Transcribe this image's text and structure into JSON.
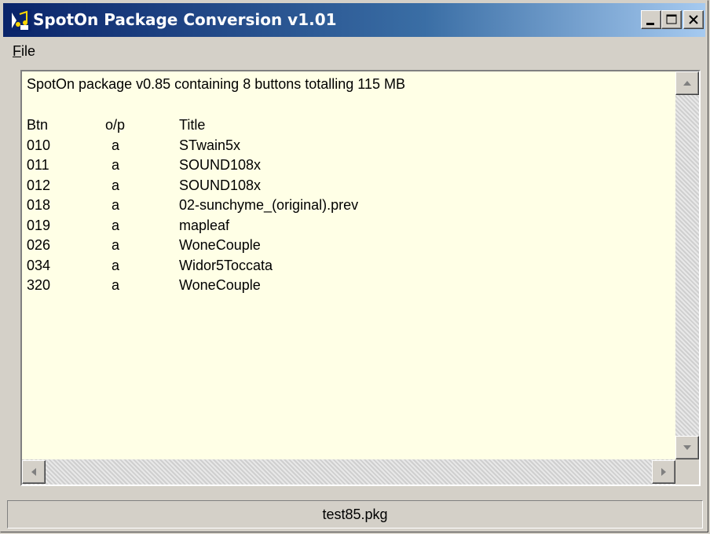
{
  "window": {
    "title": "SpotOn Package Conversion v1.01",
    "icon": "music-note-icon"
  },
  "menu": {
    "file_accel": "F",
    "file_rest": "ile"
  },
  "content": {
    "summary": "SpotOn package v0.85 containing 8 buttons totalling 115 MB",
    "columns": [
      "Btn",
      "o/p",
      "Title"
    ],
    "rows": [
      {
        "btn": "010",
        "op": "a",
        "title": "STwain5x"
      },
      {
        "btn": "011",
        "op": "a",
        "title": "SOUND108x"
      },
      {
        "btn": "012",
        "op": "a",
        "title": "SOUND108x"
      },
      {
        "btn": "018",
        "op": "a",
        "title": "02-sunchyme_(original).prev"
      },
      {
        "btn": "019",
        "op": "a",
        "title": "mapleaf"
      },
      {
        "btn": "026",
        "op": "a",
        "title": "WoneCouple"
      },
      {
        "btn": "034",
        "op": "a",
        "title": "Widor5Toccata"
      },
      {
        "btn": "320",
        "op": "a",
        "title": "WoneCouple"
      }
    ]
  },
  "statusbar": {
    "filename": "test85.pkg"
  },
  "colors": {
    "title_start": "#0a246a",
    "title_end": "#a6caf0",
    "text_bg": "#ffffe6",
    "face": "#d4d0c8"
  }
}
